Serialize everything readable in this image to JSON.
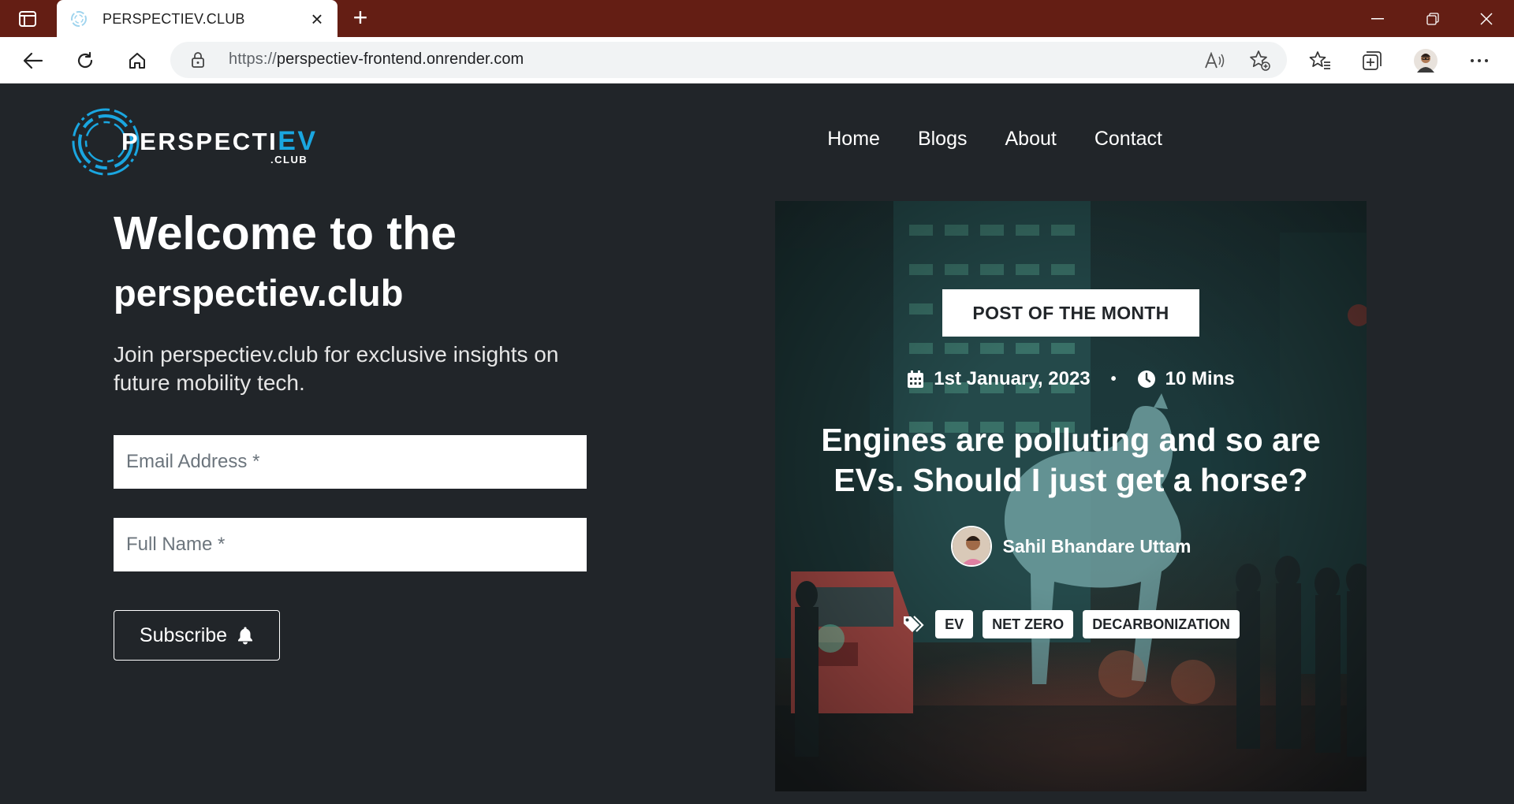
{
  "browser": {
    "tab_title": "PERSPECTIEV.CLUB",
    "url_protocol": "https://",
    "url_host": "perspectiev-frontend.onrender.com"
  },
  "site": {
    "logo_main": "PERSPECTI",
    "logo_accent": "EV",
    "logo_suffix": ".CLUB",
    "accent_color": "#1aa6e0",
    "nav": [
      "Home",
      "Blogs",
      "About",
      "Contact"
    ]
  },
  "hero": {
    "title_line1": "Welcome to the",
    "title_line2": "perspectiev.club",
    "subtitle": "Join perspectiev.club for exclusive insights on future mobility tech.",
    "email_placeholder": "Email Address *",
    "name_placeholder": "Full Name *",
    "subscribe_label": "Subscribe"
  },
  "featured": {
    "badge": "POST OF THE MONTH",
    "date": "1st January, 2023",
    "read_time": "10 Mins",
    "title": "Engines are polluting and so are EVs. Should I just get a horse?",
    "author": "Sahil Bhandare Uttam",
    "tags": [
      "EV",
      "NET ZERO",
      "DECARBONIZATION"
    ]
  }
}
